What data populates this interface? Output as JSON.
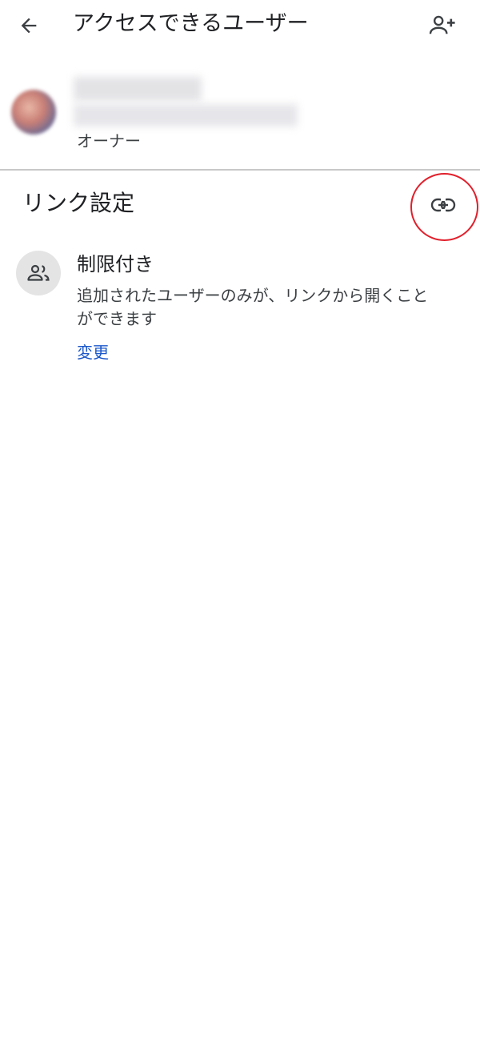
{
  "appbar": {
    "title": "アクセスできるユーザー",
    "back_icon": "arrow-left-icon",
    "add_person_icon": "person-add-icon"
  },
  "owner": {
    "name": "■■■■■",
    "email": "■■■■■■■■■■■■■■■■■■■",
    "role": "オーナー"
  },
  "link_settings": {
    "title": "リンク設定",
    "link_icon": "link-icon",
    "highlight_color": "#e0202c"
  },
  "restricted": {
    "icon": "people-icon",
    "title": "制限付き",
    "description": "追加されたユーザーのみが、リンクから開くことができます",
    "change_label": "変更",
    "link_color": "#1a57c9"
  }
}
